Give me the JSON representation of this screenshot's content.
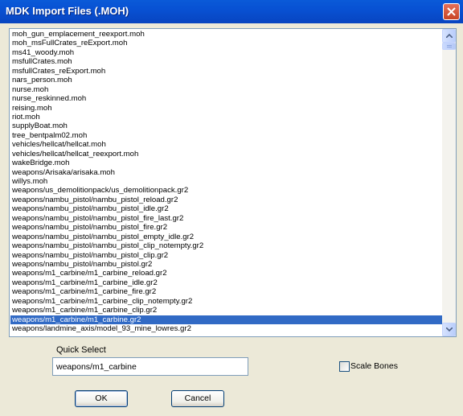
{
  "window": {
    "title": "MDK Import Files (.MOH)"
  },
  "file_list": {
    "items": [
      "moh_gun_emplacement_reexport.moh",
      "moh_msFullCrates_reExport.moh",
      "ms41_woody.moh",
      "msfullCrates.moh",
      "msfullCrates_reExport.moh",
      "nars_person.moh",
      "nurse.moh",
      "nurse_reskinned.moh",
      "reising.moh",
      "riot.moh",
      "supplyBoat.moh",
      "tree_bentpalm02.moh",
      "vehicles/hellcat/hellcat.moh",
      "vehicles/hellcat/hellcat_reexport.moh",
      "wakeBridge.moh",
      "weapons/Arisaka/arisaka.moh",
      "willys.moh",
      "weapons/us_demolitionpack/us_demolitionpack.gr2",
      "weapons/nambu_pistol/nambu_pistol_reload.gr2",
      "weapons/nambu_pistol/nambu_pistol_idle.gr2",
      "weapons/nambu_pistol/nambu_pistol_fire_last.gr2",
      "weapons/nambu_pistol/nambu_pistol_fire.gr2",
      "weapons/nambu_pistol/nambu_pistol_empty_idle.gr2",
      "weapons/nambu_pistol/nambu_pistol_clip_notempty.gr2",
      "weapons/nambu_pistol/nambu_pistol_clip.gr2",
      "weapons/nambu_pistol/nambu_pistol.gr2",
      "weapons/m1_carbine/m1_carbine_reload.gr2",
      "weapons/m1_carbine/m1_carbine_idle.gr2",
      "weapons/m1_carbine/m1_carbine_fire.gr2",
      "weapons/m1_carbine/m1_carbine_clip_notempty.gr2",
      "weapons/m1_carbine/m1_carbine_clip.gr2",
      "weapons/m1_carbine/m1_carbine.gr2",
      "weapons/landmine_axis/model_93_mine_lowres.gr2"
    ],
    "selected_index": 31
  },
  "quick_select": {
    "label": "Quick Select",
    "value": "weapons/m1_carbine"
  },
  "scale_bones": {
    "label": "Scale Bones",
    "checked": false
  },
  "buttons": {
    "ok": "OK",
    "cancel": "Cancel"
  },
  "colors": {
    "title_bar": "#0a5ad8",
    "selection": "#316ac5",
    "dialog_bg": "#ece9d8"
  }
}
